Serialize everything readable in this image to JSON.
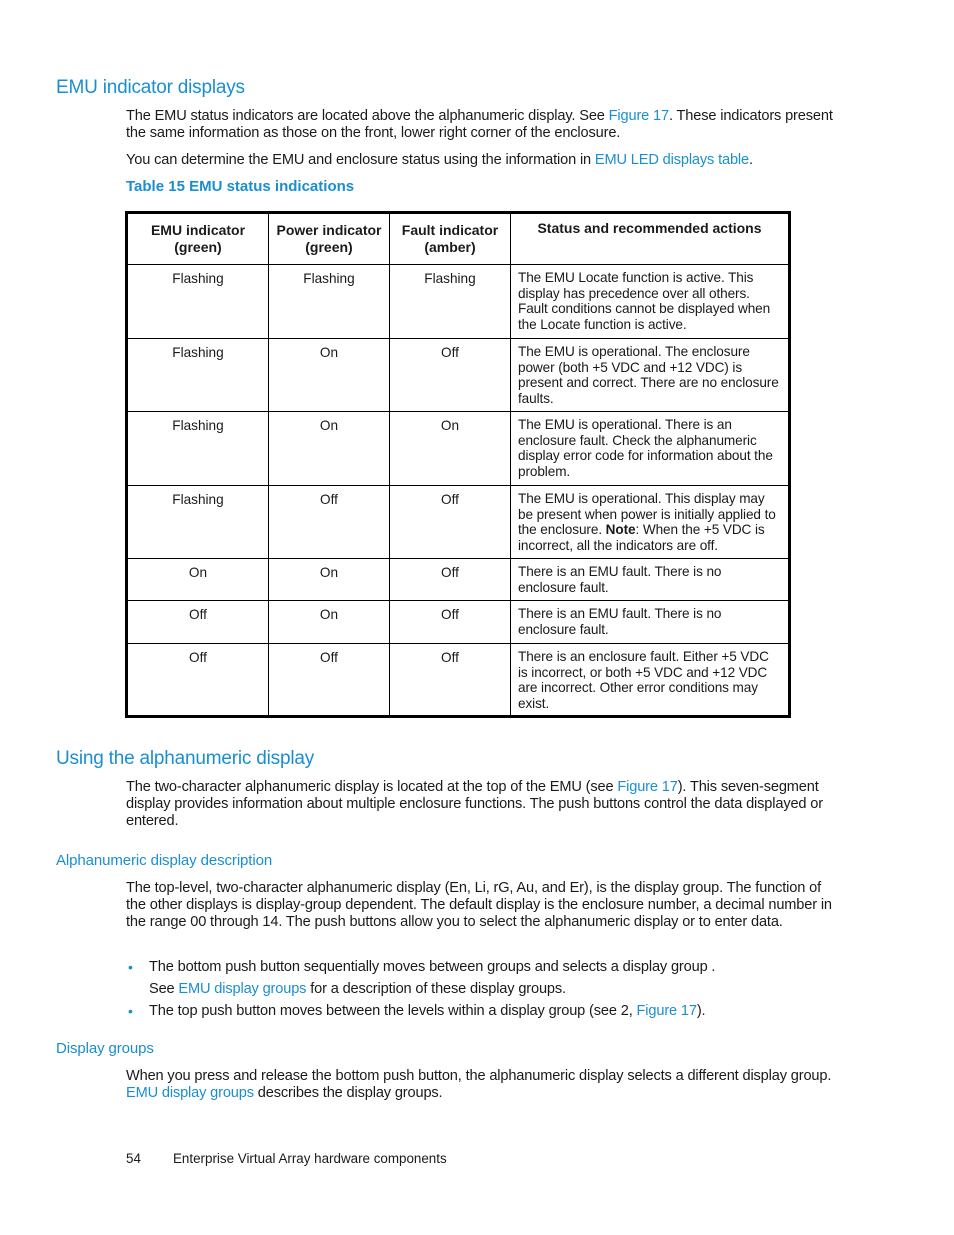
{
  "sections": {
    "emu_indicator": {
      "heading": "EMU indicator displays",
      "p1_pre": "The EMU status indicators are located above the alphanumeric display.  See ",
      "p1_link": "Figure 17",
      "p1_post": ".  These indicators present the same information as those on the front, lower right corner of the enclosure.",
      "p2_pre": "You can determine the EMU and enclosure status using the information in ",
      "p2_link": "EMU LED displays table",
      "p2_post": "."
    },
    "table": {
      "caption": "Table 15 EMU status indications",
      "headers": [
        {
          "line1": "EMU indicator",
          "line2": "(green)"
        },
        {
          "line1": "Power indicator",
          "line2": "(green)"
        },
        {
          "line1": "Fault indicator",
          "line2": "(amber)"
        },
        {
          "line1": "Status and recommended actions",
          "line2": ""
        }
      ],
      "rows": [
        {
          "emu": "Flashing",
          "power": "Flashing",
          "fault": "Flashing",
          "status_pre": "The EMU Locate function is active.  This display has precedence over all others. Fault conditions cannot be displayed when the Locate function is active.",
          "note_label": "",
          "status_post": ""
        },
        {
          "emu": "Flashing",
          "power": "On",
          "fault": "Off",
          "status_pre": "The EMU is operational.  The enclosure power (both +5 VDC and +12 VDC) is present and correct.  There are no enclosure faults.",
          "note_label": "",
          "status_post": ""
        },
        {
          "emu": "Flashing",
          "power": "On",
          "fault": "On",
          "status_pre": "The EMU is operational.  There is an enclosure fault.  Check the alphanumeric display error code for information about the problem.",
          "note_label": "",
          "status_post": ""
        },
        {
          "emu": "Flashing",
          "power": "Off",
          "fault": "Off",
          "status_pre": "The EMU is operational.  This display may be present when power is initially applied to the enclosure. ",
          "note_label": "Note",
          "status_post": ":  When the +5 VDC is incorrect, all the indicators are off."
        },
        {
          "emu": "On",
          "power": "On",
          "fault": "Off",
          "status_pre": "There is an EMU fault.  There is no enclosure fault.",
          "note_label": "",
          "status_post": ""
        },
        {
          "emu": "Off",
          "power": "On",
          "fault": "Off",
          "status_pre": "There is an EMU fault.  There is no enclosure fault.",
          "note_label": "",
          "status_post": ""
        },
        {
          "emu": "Off",
          "power": "Off",
          "fault": "Off",
          "status_pre": "There is an enclosure fault.  Either +5 VDC is incorrect, or both +5 VDC and +12 VDC are incorrect.  Other error conditions may exist.",
          "note_label": "",
          "status_post": ""
        }
      ]
    },
    "alphanumeric": {
      "heading": "Using the alphanumeric display",
      "p1_pre": "The two-character alphanumeric display is located at the top of the EMU (see ",
      "p1_link": "Figure 17",
      "p1_post": ").  This seven-segment display provides information about multiple enclosure functions.  The push buttons control the data displayed or entered."
    },
    "description": {
      "heading": "Alphanumeric display description",
      "p1": "The top-level, two-character alphanumeric display (En, Li, rG, Au, and Er), is the display group.  The function of the other displays is display-group dependent.  The default display is the enclosure number, a decimal number in the range 00 through 14.  The push buttons allow you to select the alphanumeric display or to enter data.",
      "bullets": [
        {
          "text": "The bottom push button sequentially moves between groups and selects a display group .",
          "sub_pre": "See ",
          "sub_link": "EMU display groups",
          "sub_post": " for a description of these display groups."
        },
        {
          "text_pre": "The top push button moves between the levels within a display group (see 2, ",
          "text_link": "Figure 17",
          "text_post": ")."
        }
      ]
    },
    "display_groups": {
      "heading": "Display groups",
      "p1_pre": "When you press and release the bottom push button, the alphanumeric display selects a different display group.  ",
      "p1_link": "EMU display groups",
      "p1_post": " describes the display groups."
    }
  },
  "footer": {
    "page_number": "54",
    "chapter_title": "Enterprise Virtual Array hardware components"
  },
  "colors": {
    "heading_blue": "#1a8fcf",
    "link_blue": "#1a8fcf",
    "text": "#1a1a1a"
  }
}
